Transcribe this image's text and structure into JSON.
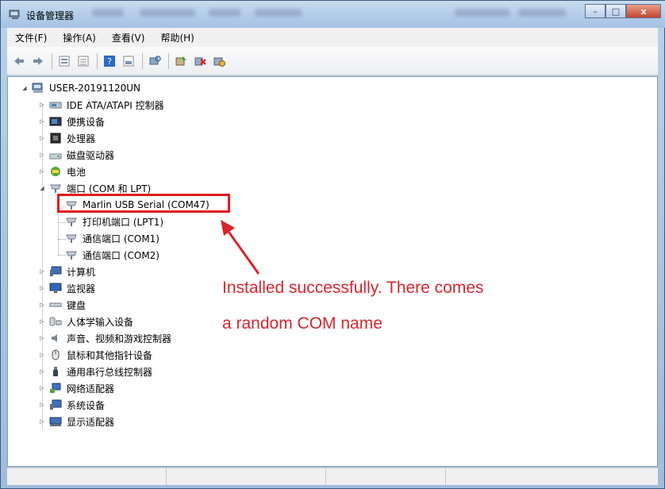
{
  "window": {
    "title": "设备管理器",
    "caption_buttons": {
      "minimize": "–",
      "maximize": "□",
      "close": "x"
    }
  },
  "menu": [
    "文件(F)",
    "操作(A)",
    "查看(V)",
    "帮助(H)"
  ],
  "toolbar": {
    "icons": [
      "back-icon",
      "forward-icon",
      "properties-icon",
      "update-list-icon",
      "help-icon",
      "view-icon",
      "scan-hardware-icon",
      "update-driver-icon",
      "uninstall-icon",
      "disable-icon"
    ]
  },
  "tree": {
    "root": "USER-20191120UN",
    "items": [
      {
        "label": "IDE ATA/ATAPI 控制器",
        "icon": "ide-controller-icon"
      },
      {
        "label": "便携设备",
        "icon": "portable-device-icon"
      },
      {
        "label": "处理器",
        "icon": "processor-icon"
      },
      {
        "label": "磁盘驱动器",
        "icon": "disk-drive-icon"
      },
      {
        "label": "电池",
        "icon": "battery-icon"
      },
      {
        "label": "端口 (COM 和 LPT)",
        "icon": "port-icon",
        "expanded": true,
        "children": [
          {
            "label": "Marlin USB Serial (COM47)",
            "icon": "serial-port-icon",
            "selected": true
          },
          {
            "label": "打印机端口 (LPT1)",
            "icon": "printer-port-icon"
          },
          {
            "label": "通信端口 (COM1)",
            "icon": "comm-port-icon"
          },
          {
            "label": "通信端口 (COM2)",
            "icon": "comm-port-icon"
          }
        ]
      },
      {
        "label": "计算机",
        "icon": "computer-icon"
      },
      {
        "label": "监视器",
        "icon": "monitor-icon"
      },
      {
        "label": "键盘",
        "icon": "keyboard-icon"
      },
      {
        "label": "人体学输入设备",
        "icon": "hid-icon"
      },
      {
        "label": "声音、视频和游戏控制器",
        "icon": "sound-icon"
      },
      {
        "label": "鼠标和其他指针设备",
        "icon": "mouse-icon"
      },
      {
        "label": "通用串行总线控制器",
        "icon": "usb-icon"
      },
      {
        "label": "网络适配器",
        "icon": "network-adapter-icon"
      },
      {
        "label": "系统设备",
        "icon": "system-device-icon"
      },
      {
        "label": "显示适配器",
        "icon": "display-adapter-icon"
      }
    ]
  },
  "annotation": {
    "line1": "Installed successfully. There comes",
    "line2": "a random COM name",
    "color": "#d6262c"
  }
}
